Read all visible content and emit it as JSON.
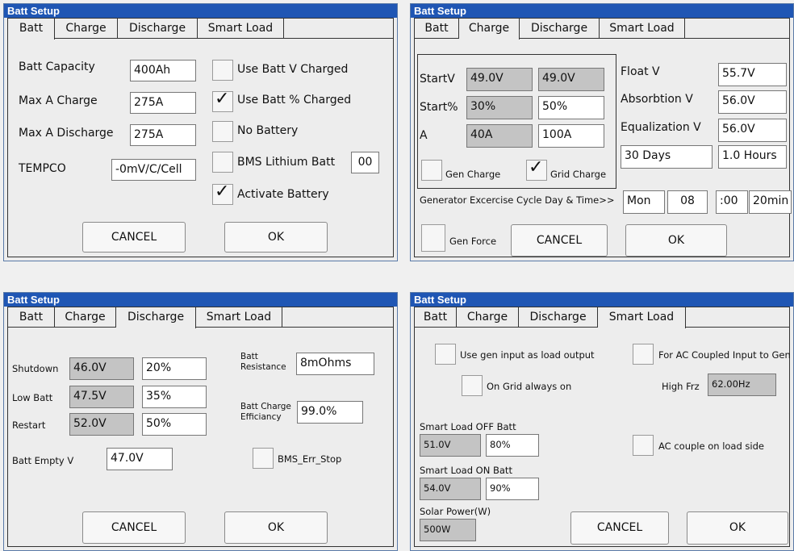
{
  "common": {
    "title": "Batt Setup",
    "tabs": [
      "Batt",
      "Charge",
      "Discharge",
      "Smart Load"
    ],
    "cancel": "CANCEL",
    "ok": "OK"
  },
  "batt": {
    "capacity_label": "Batt Capacity",
    "capacity": "400Ah",
    "max_charge_label": "Max A Charge",
    "max_charge": "275A",
    "max_discharge_label": "Max A Discharge",
    "max_discharge": "275A",
    "tempco_label": "TEMPCO",
    "tempco": "-0mV/C/Cell",
    "use_batt_v": "Use Batt V Charged",
    "use_batt_pct": "Use Batt % Charged",
    "no_battery": "No Battery",
    "bms_lithium": "BMS Lithium Batt",
    "bms_code": "00",
    "activate": "Activate Battery",
    "check_mark": "✓"
  },
  "charge": {
    "startv_label": "StartV",
    "startv_1": "49.0V",
    "startv_2": "49.0V",
    "startpct_label": "Start%",
    "startpct_1": "30%",
    "startpct_2": "50%",
    "a_label": "A",
    "a_1": "40A",
    "a_2": "100A",
    "gen_charge": "Gen Charge",
    "grid_charge": "Grid Charge",
    "float_label": "Float V",
    "float": "55.7V",
    "absorb_label": "Absorbtion V",
    "absorb": "56.0V",
    "equal_label": "Equalization V",
    "equal": "56.0V",
    "days": "30 Days",
    "hours": "1.0 Hours",
    "gen_cycle_label": "Generator Excercise Cycle Day & Time>>",
    "day": "Mon",
    "hour": "08",
    "minute": ":00",
    "duration": "20min",
    "gen_force": "Gen Force"
  },
  "discharge": {
    "shutdown_label": "Shutdown",
    "shutdown_v": "46.0V",
    "shutdown_pct": "20%",
    "lowbatt_label": "Low Batt",
    "lowbatt_v": "47.5V",
    "lowbatt_pct": "35%",
    "restart_label": "Restart",
    "restart_v": "52.0V",
    "restart_pct": "50%",
    "empty_label": "Batt Empty V",
    "empty_v": "47.0V",
    "resistance_label_1": "Batt",
    "resistance_label_2": "Resistance",
    "resistance": "8mOhms",
    "efficiency_label_1": "Batt Charge",
    "efficiency_label_2": "Efficiancy",
    "efficiency": "99.0%",
    "bms_err_stop": "BMS_Err_Stop"
  },
  "smartload": {
    "use_gen_input": "Use gen input as load output",
    "ac_coupled_gen": "For AC Coupled Input to Gen",
    "on_grid_always": "On Grid always on",
    "high_frz_label": "High Frz",
    "high_frz": "62.00Hz",
    "off_batt_label": "Smart Load OFF Batt",
    "off_batt_v": "51.0V",
    "off_batt_pct": "80%",
    "ac_couple_load": "AC couple on load side",
    "on_batt_label": "Smart Load ON Batt",
    "on_batt_v": "54.0V",
    "on_batt_pct": "90%",
    "solar_label": "Solar Power(W)",
    "solar": "500W"
  }
}
